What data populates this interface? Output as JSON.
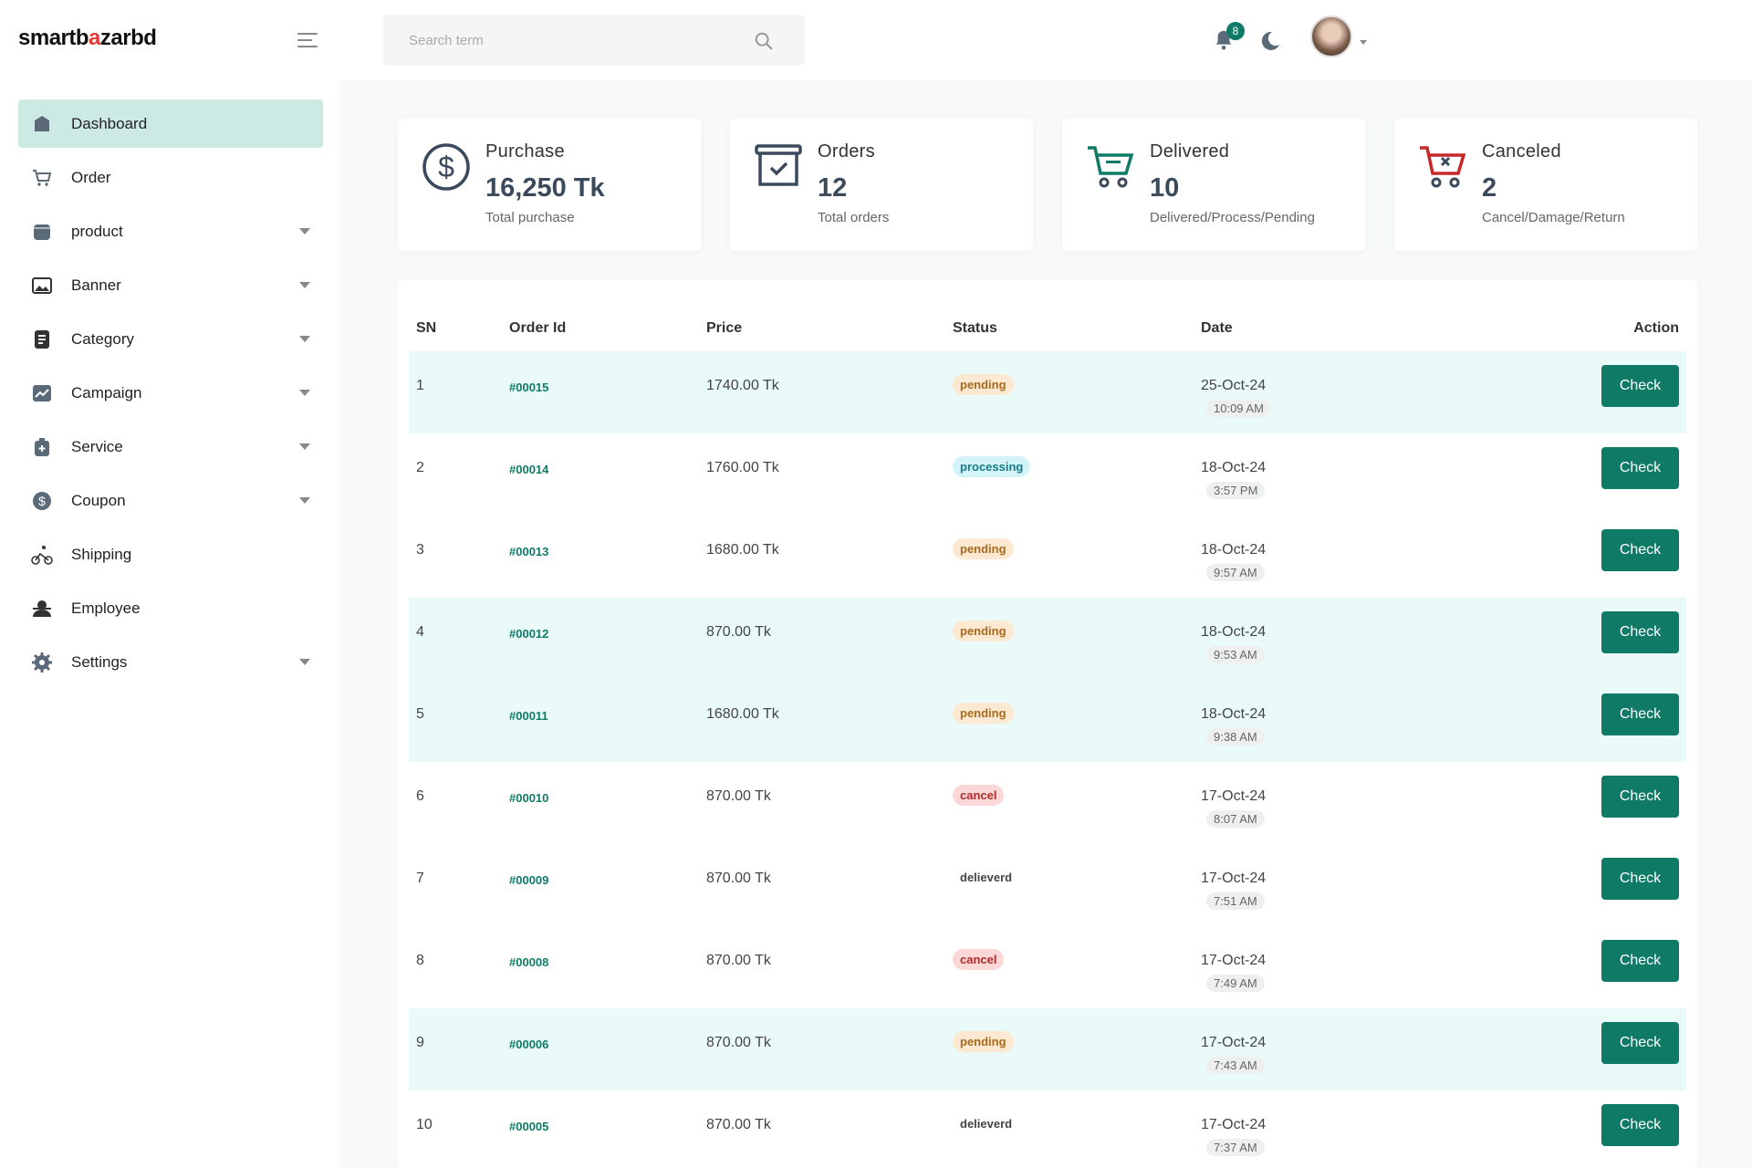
{
  "brand": {
    "logo_pre": "smartb",
    "logo_accent": "a",
    "logo_post": "zarbd"
  },
  "search": {
    "placeholder": "Search term"
  },
  "header": {
    "notification_count": "8"
  },
  "sidebar": {
    "items": [
      {
        "label": "Dashboard",
        "icon": "dashboard-icon",
        "active": true,
        "dropdown": false
      },
      {
        "label": "Order",
        "icon": "cart-icon",
        "active": false,
        "dropdown": false
      },
      {
        "label": "product",
        "icon": "box-icon",
        "active": false,
        "dropdown": true
      },
      {
        "label": "Banner",
        "icon": "image-icon",
        "active": false,
        "dropdown": true
      },
      {
        "label": "Category",
        "icon": "list-icon",
        "active": false,
        "dropdown": true
      },
      {
        "label": "Campaign",
        "icon": "chart-icon",
        "active": false,
        "dropdown": true
      },
      {
        "label": "Service",
        "icon": "medkit-icon",
        "active": false,
        "dropdown": true
      },
      {
        "label": "Coupon",
        "icon": "dollar-icon",
        "active": false,
        "dropdown": true
      },
      {
        "label": "Shipping",
        "icon": "bike-icon",
        "active": false,
        "dropdown": false
      },
      {
        "label": "Employee",
        "icon": "user-icon",
        "active": false,
        "dropdown": false
      },
      {
        "label": "Settings",
        "icon": "gear-icon",
        "active": false,
        "dropdown": true
      }
    ]
  },
  "stats": [
    {
      "title": "Purchase",
      "value": "16,250 Tk",
      "sub": "Total purchase",
      "icon": "dollar-circle-icon"
    },
    {
      "title": "Orders",
      "value": "12",
      "sub": "Total orders",
      "icon": "box-check-icon"
    },
    {
      "title": "Delivered",
      "value": "10",
      "sub": "Delivered/Process/Pending",
      "icon": "cart-delivered-icon"
    },
    {
      "title": "Canceled",
      "value": "2",
      "sub": "Cancel/Damage/Return",
      "icon": "cart-cancel-icon"
    }
  ],
  "table": {
    "headers": {
      "sn": "SN",
      "order_id": "Order Id",
      "price": "Price",
      "status": "Status",
      "date": "Date",
      "action": "Action"
    },
    "rows": [
      {
        "sn": "1",
        "order_id": "#00015",
        "price": "1740.00 Tk",
        "status": "pending",
        "date": "25-Oct-24",
        "time": "10:09 AM",
        "action": "Check",
        "highlight": true
      },
      {
        "sn": "2",
        "order_id": "#00014",
        "price": "1760.00 Tk",
        "status": "processing",
        "date": "18-Oct-24",
        "time": "3:57 PM",
        "action": "Check",
        "highlight": false
      },
      {
        "sn": "3",
        "order_id": "#00013",
        "price": "1680.00 Tk",
        "status": "pending",
        "date": "18-Oct-24",
        "time": "9:57 AM",
        "action": "Check",
        "highlight": false
      },
      {
        "sn": "4",
        "order_id": "#00012",
        "price": "870.00 Tk",
        "status": "pending",
        "date": "18-Oct-24",
        "time": "9:53 AM",
        "action": "Check",
        "highlight": true
      },
      {
        "sn": "5",
        "order_id": "#00011",
        "price": "1680.00 Tk",
        "status": "pending",
        "date": "18-Oct-24",
        "time": "9:38 AM",
        "action": "Check",
        "highlight": true
      },
      {
        "sn": "6",
        "order_id": "#00010",
        "price": "870.00 Tk",
        "status": "cancel",
        "date": "17-Oct-24",
        "time": "8:07 AM",
        "action": "Check",
        "highlight": false
      },
      {
        "sn": "7",
        "order_id": "#00009",
        "price": "870.00 Tk",
        "status": "delieverd",
        "date": "17-Oct-24",
        "time": "7:51 AM",
        "action": "Check",
        "highlight": false
      },
      {
        "sn": "8",
        "order_id": "#00008",
        "price": "870.00 Tk",
        "status": "cancel",
        "date": "17-Oct-24",
        "time": "7:49 AM",
        "action": "Check",
        "highlight": false
      },
      {
        "sn": "9",
        "order_id": "#00006",
        "price": "870.00 Tk",
        "status": "pending",
        "date": "17-Oct-24",
        "time": "7:43 AM",
        "action": "Check",
        "highlight": true
      },
      {
        "sn": "10",
        "order_id": "#00005",
        "price": "870.00 Tk",
        "status": "delieverd",
        "date": "17-Oct-24",
        "time": "7:37 AM",
        "action": "Check",
        "highlight": false
      }
    ]
  },
  "colors": {
    "accent": "#0f7b67",
    "active_nav": "#cde9e4",
    "row_highlight": "#eafaf9"
  }
}
